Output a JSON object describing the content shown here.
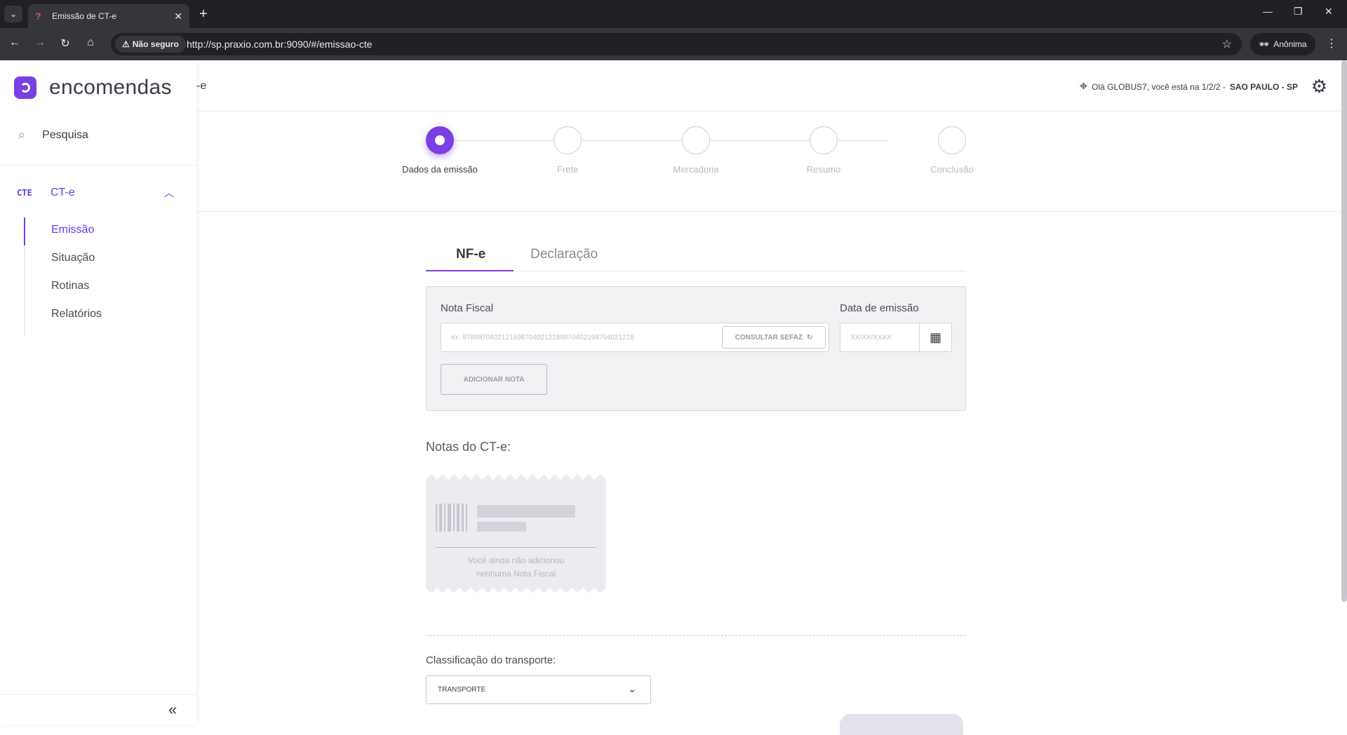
{
  "browser": {
    "tab_title": "Emissão de CT-e",
    "security_label": "Não seguro",
    "url": "http://sp.praxio.com.br:9090/#/emissao-cte",
    "profile_label": "Anônima"
  },
  "sidebar": {
    "brand": "encomendas",
    "search_label": "Pesquisa",
    "group": {
      "abbr": "CTE",
      "label": "CT-e"
    },
    "items": [
      {
        "label": "Emissão",
        "active": true
      },
      {
        "label": "Situação"
      },
      {
        "label": "Rotinas"
      },
      {
        "label": "Relatórios"
      }
    ]
  },
  "header": {
    "crumb": "-e",
    "greeting_prefix": "Olá GLOBUS7, você está na 1/2/2 -",
    "greeting_location": "SAO PAULO - SP"
  },
  "stepper": {
    "steps": [
      {
        "label": "Dados da emissão",
        "active": true
      },
      {
        "label": "Frete"
      },
      {
        "label": "Mercadoria"
      },
      {
        "label": "Resumo"
      },
      {
        "label": "Conclusão"
      }
    ]
  },
  "tabs": {
    "nfe": "NF-e",
    "declaracao": "Declaração"
  },
  "form": {
    "nota_label": "Nota Fiscal",
    "nota_placeholder": "ex: 97898704021218987040212189870402198704021218",
    "sefaz_label": "CONSULTAR SEFAZ",
    "data_label": "Data de emissão",
    "data_placeholder": "XX/XX/XXXX",
    "add_label": "ADICIONAR NOTA"
  },
  "notes": {
    "title": "Notas do CT-e:",
    "empty_line1": "Você ainda não adicionou",
    "empty_line2": "nenhuma Nota Fiscal"
  },
  "transport": {
    "label": "Classificação do transporte:",
    "value": "TRANSPORTE"
  },
  "colors": {
    "accent": "#7b3fe4"
  }
}
